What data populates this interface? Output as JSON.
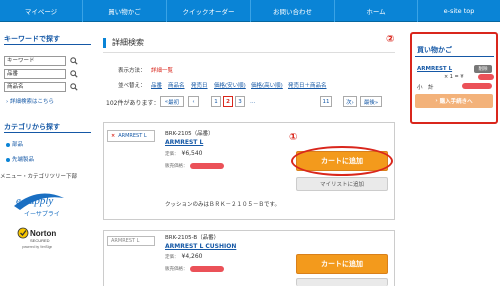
{
  "nav": {
    "items": [
      "マイページ",
      "買い物かご",
      "クイックオーダー",
      "お問い合わせ",
      "ホーム",
      "e-site top"
    ]
  },
  "left": {
    "keyword_title": "キーワードで探す",
    "fields": [
      "キーワード",
      "品番",
      "商品名"
    ],
    "advanced_link": "詳細検索はこちら",
    "category_title": "カテゴリから探す",
    "categories": [
      "部品",
      "先端製品"
    ],
    "menu_label": "メニュー・カテゴリツリー下部",
    "esupply_text": "e-supply",
    "esupply_sub": "イーサプライ",
    "norton_text": "Norton",
    "norton_sub": "SECURED",
    "norton_by": "powered by VeriSign"
  },
  "main": {
    "title": "詳細検索",
    "display_label": "表示方法：",
    "display_value": "詳細一覧",
    "sort_label": "並べ替え：",
    "sort_options": [
      "品番",
      "商品名",
      "発売日",
      "価格(安い順)",
      "価格(高い順)",
      "発売日＋商品名"
    ],
    "count_label": "102件があります：",
    "pager": [
      "«",
      "最初",
      "‹",
      "1",
      "2",
      "3",
      "11",
      "次›",
      "最後»"
    ],
    "pager_ellipsis": "…",
    "products": [
      {
        "thumb_label": "ARMREST L",
        "code": "BRK-2105（品番）",
        "name": "ARMREST L",
        "list_label": "定価：",
        "price": "¥6,540",
        "sale_label": "販売価格：",
        "cart_button": "カートに追加",
        "mylist_button": "マイリストに追加",
        "description": "クッションのみはＢＲＫ－２１０５－Ｂです。"
      },
      {
        "thumb_label": "ARMREST L",
        "code": "BRK-2105-B（品番）",
        "name": "ARMREST L CUSHION",
        "list_label": "定価：",
        "price": "¥4,260",
        "sale_label": "販売価格：",
        "cart_button": "カートに追加",
        "mylist_button": ""
      }
    ]
  },
  "cart": {
    "title": "買い物かご",
    "item": "ARMREST L",
    "delete_label": "削除",
    "qty": "× 1 = ¥",
    "subtotal": "小　計",
    "proceed": "購入手続きへ"
  },
  "markers": [
    "①",
    "②"
  ],
  "colors": {
    "nav": "#0a84d6",
    "accent": "#d9261c",
    "cart_button": "#f39a1c",
    "link": "#1558a6"
  }
}
